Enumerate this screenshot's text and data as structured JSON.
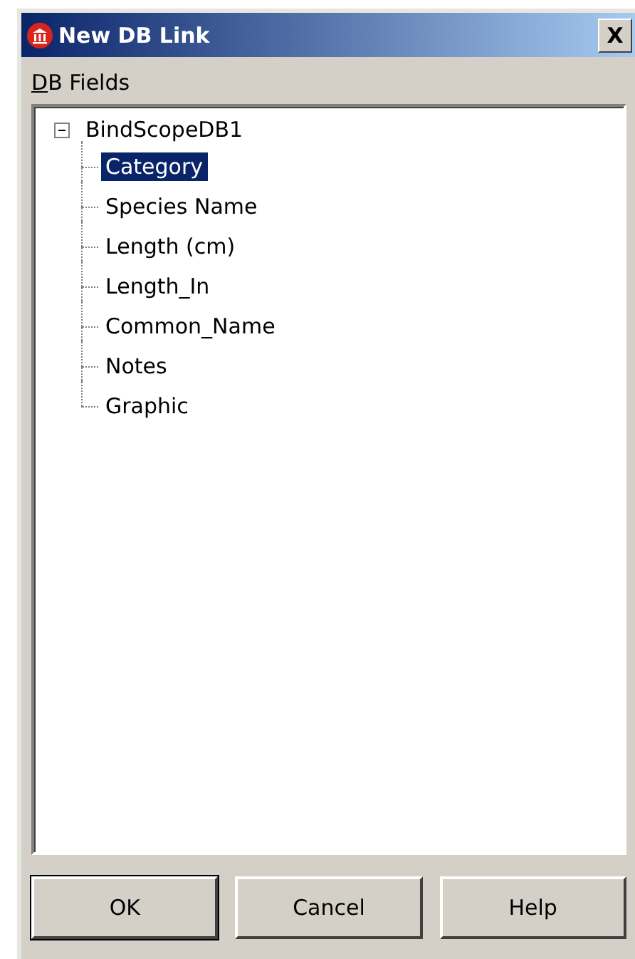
{
  "window": {
    "title": "New DB Link",
    "close": "X"
  },
  "fields_label": "DB Fields",
  "tree": {
    "label": "BindScopeDB1",
    "expanded": true,
    "children": [
      {
        "label": "Category",
        "selected": true
      },
      {
        "label": "Species Name",
        "selected": false
      },
      {
        "label": "Length (cm)",
        "selected": false
      },
      {
        "label": "Length_In",
        "selected": false
      },
      {
        "label": "Common_Name",
        "selected": false
      },
      {
        "label": "Notes",
        "selected": false
      },
      {
        "label": "Graphic",
        "selected": false
      }
    ]
  },
  "buttons": [
    {
      "label": "OK",
      "default": true
    },
    {
      "label": "Cancel",
      "default": false
    },
    {
      "label": "Help",
      "default": false
    }
  ]
}
